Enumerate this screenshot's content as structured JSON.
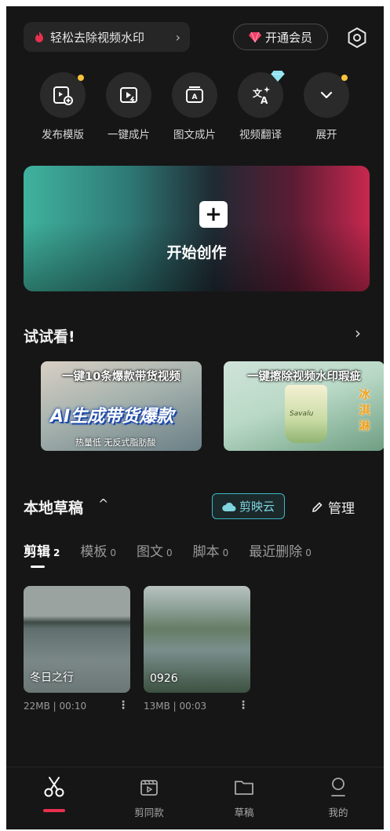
{
  "top_bar": {
    "promo_text": "轻松去除视频水印",
    "vip_label": "开通会员"
  },
  "tools": [
    {
      "label": "发布模版",
      "icon": "publish-template-icon",
      "badge_dot": true
    },
    {
      "label": "一键成片",
      "icon": "one-click-video-icon",
      "badge_dot": false
    },
    {
      "label": "图文成片",
      "icon": "image-text-video-icon",
      "badge_dot": false
    },
    {
      "label": "视频翻译",
      "icon": "translate-icon",
      "badge_dot": false
    },
    {
      "label": "展开",
      "icon": "chevron-down-icon",
      "badge_dot": true
    }
  ],
  "hero": {
    "label": "开始创作"
  },
  "try_section": {
    "title": "试试看!",
    "cards": [
      {
        "title": "一键10条爆款带货视频",
        "big_text": "AI生成带货爆款",
        "sub_text": "热量低 无反式脂肪酸"
      },
      {
        "title": "一键擦除视频水印瑕疵",
        "cup_text": "Savalu",
        "side_text": "冰淇淋"
      }
    ]
  },
  "drafts": {
    "title": "本地草稿",
    "cloud_label": "剪映云",
    "manage_label": "管理",
    "tabs": [
      {
        "label": "剪辑",
        "count": "2",
        "active": true
      },
      {
        "label": "模板",
        "count": "0",
        "active": false
      },
      {
        "label": "图文",
        "count": "0",
        "active": false
      },
      {
        "label": "脚本",
        "count": "0",
        "active": false
      },
      {
        "label": "最近删除",
        "count": "0",
        "active": false
      }
    ],
    "items": [
      {
        "name": "冬日之行",
        "meta": "22MB | 00:10"
      },
      {
        "name": "0926",
        "meta": "13MB | 00:03"
      }
    ]
  },
  "bottom_nav": [
    {
      "label": "",
      "icon": "scissors-icon",
      "active": true
    },
    {
      "label": "剪同款",
      "icon": "clapper-icon",
      "active": false
    },
    {
      "label": "草稿",
      "icon": "folder-icon",
      "active": false
    },
    {
      "label": "我的",
      "icon": "profile-icon",
      "active": false
    }
  ],
  "colors": {
    "background": "#161616",
    "accent": "#e8304e",
    "cloud": "#3fb6c3",
    "badge": "#f5c33b"
  }
}
